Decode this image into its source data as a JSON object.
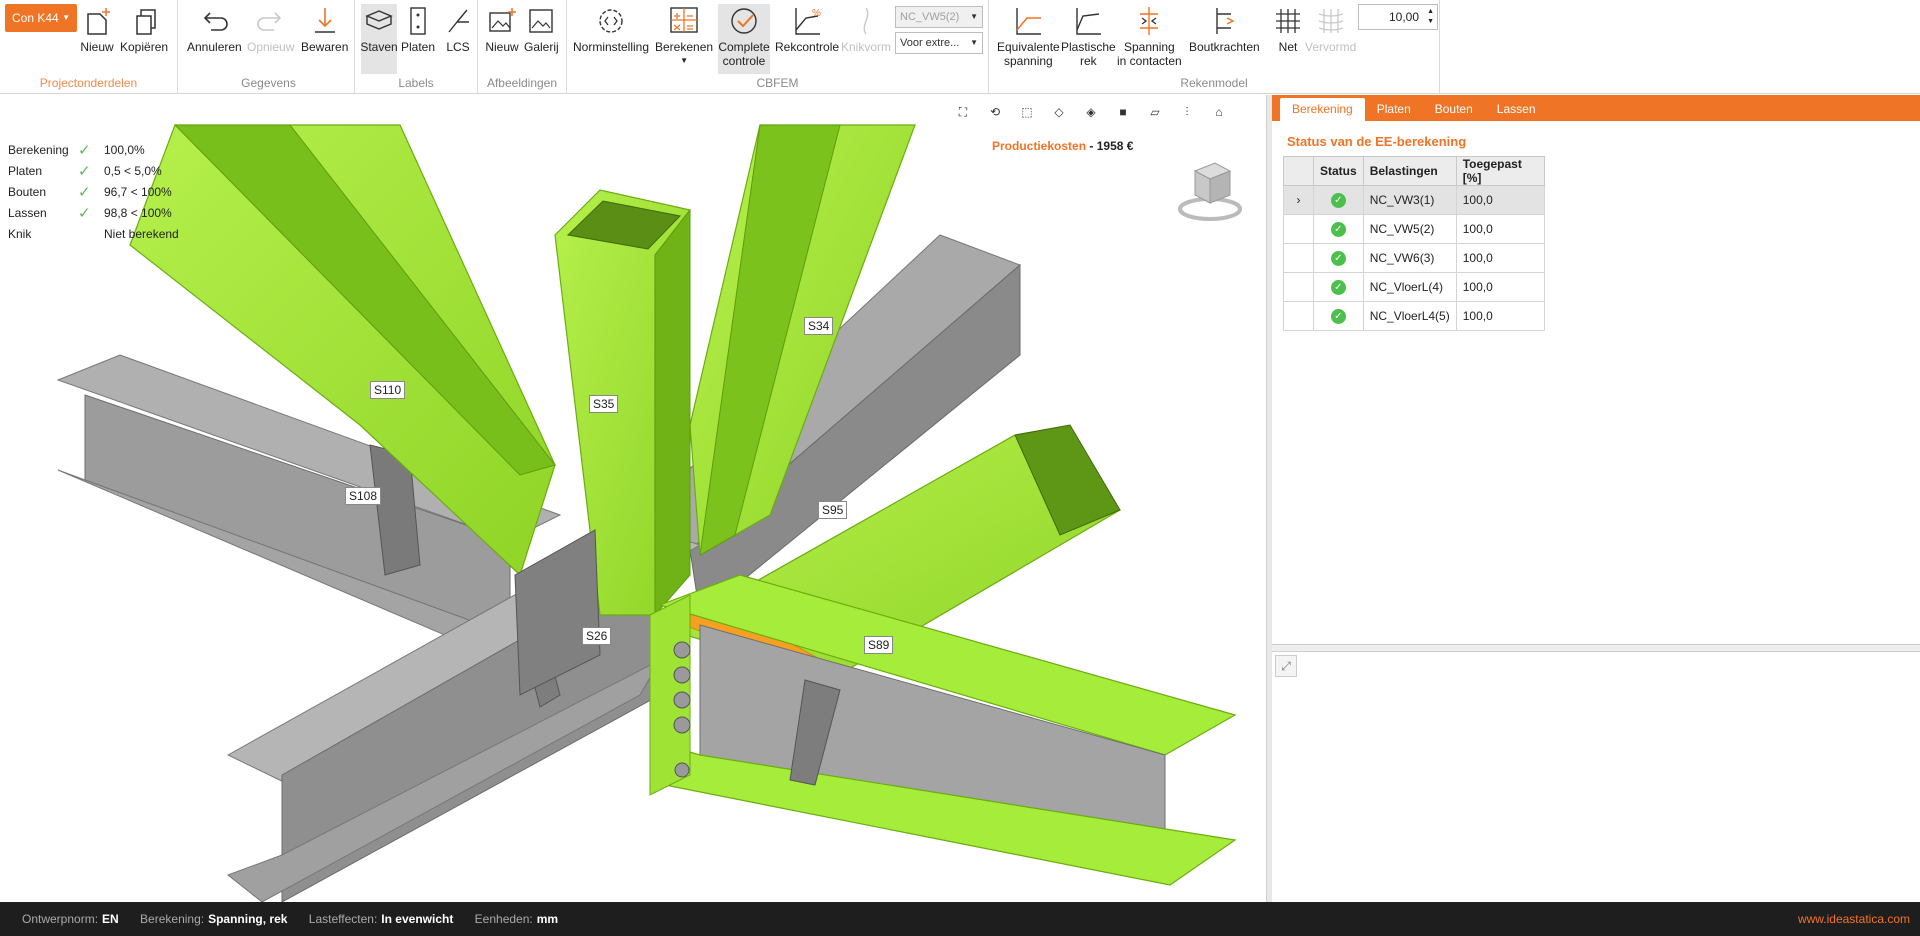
{
  "ribbon": {
    "project": {
      "selector": "Con K44",
      "new": "Nieuw",
      "copy": "Kopiëren",
      "group": "Projectonderdelen"
    },
    "data": {
      "undo": "Annuleren",
      "redo": "Opnieuw",
      "save": "Bewaren",
      "group": "Gegevens"
    },
    "labels": {
      "members": "Staven",
      "plates": "Platen",
      "lcs": "LCS",
      "group": "Labels"
    },
    "images": {
      "new": "Nieuw",
      "gallery": "Galerij",
      "group": "Afbeeldingen"
    },
    "cbfem": {
      "norm": "Norminstelling",
      "calculate": "Berekenen",
      "full_check": "Complete\ncontrole",
      "strain_check": "Rekcontrole",
      "buckling": "Knikvorm",
      "loadcase": "NC_VW5(2)",
      "extreme": "Voor extre...",
      "group": "CBFEM"
    },
    "model": {
      "eq_stress": "Equivalente\nspanning",
      "plastic": "Plastische\nrek",
      "contact": "Spanning\nin contacten",
      "bolts": "Boutkrachten",
      "mesh": "Net",
      "deformed": "Vervormd",
      "scale": "10,00",
      "group": "Rekenmodel"
    }
  },
  "viewport": {
    "summary": [
      {
        "label": "Berekening",
        "check": true,
        "value": "100,0%"
      },
      {
        "label": "Platen",
        "check": true,
        "value": "0,5 < 5,0%"
      },
      {
        "label": "Bouten",
        "check": true,
        "value": "96,7 < 100%"
      },
      {
        "label": "Lassen",
        "check": true,
        "value": "98,8 < 100%"
      },
      {
        "label": "Knik",
        "check": false,
        "value": "Niet berekend"
      }
    ],
    "cost_label": "Productiekosten",
    "cost_sep": "-",
    "cost_value": "1958 €",
    "members": [
      "S110",
      "S35",
      "S34",
      "S108",
      "S95",
      "S26",
      "S89"
    ]
  },
  "panel": {
    "tabs": [
      "Berekening",
      "Platen",
      "Bouten",
      "Lassen"
    ],
    "title": "Status van de EE-berekening",
    "columns": [
      "Status",
      "Belastingen",
      "Toegepast [%]"
    ],
    "rows": [
      {
        "load": "NC_VW3(1)",
        "applied": "100,0"
      },
      {
        "load": "NC_VW5(2)",
        "applied": "100,0"
      },
      {
        "load": "NC_VW6(3)",
        "applied": "100,0"
      },
      {
        "load": "NC_VloerL(4)",
        "applied": "100,0"
      },
      {
        "load": "NC_VloerL4(5)",
        "applied": "100,0"
      }
    ]
  },
  "footer": {
    "design_code_label": "Ontwerpnorm:",
    "design_code": "EN",
    "analysis_label": "Berekening:",
    "analysis": "Spanning, rek",
    "load_effects_label": "Lasteffecten:",
    "load_effects": "In evenwicht",
    "units_label": "Eenheden:",
    "units": "mm",
    "url": "www.ideastatica.com"
  },
  "colors": {
    "accent": "#f07426",
    "member": "#a6ec3a",
    "steel": "#9a9a9a",
    "ok": "#4cbf4c"
  }
}
